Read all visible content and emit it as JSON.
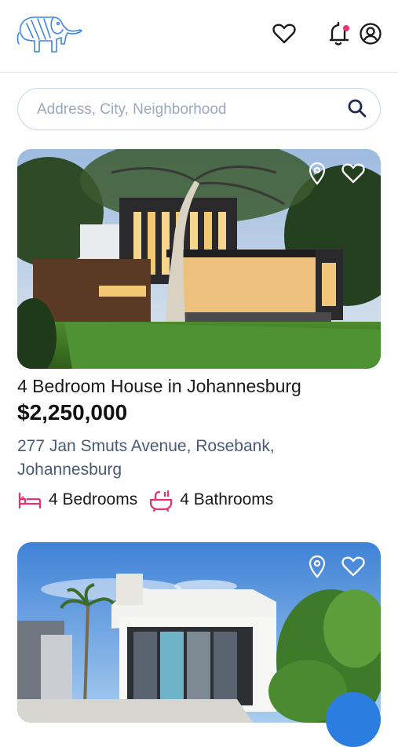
{
  "header": {
    "logo_icon": "elephant-logo",
    "favorites_icon": "heart-outline-icon",
    "notifications_icon": "bell-icon",
    "notification_dot_color": "#e8336e",
    "profile_icon": "user-circle-icon"
  },
  "search": {
    "placeholder": "Address, City, Neighborhood",
    "value": "",
    "icon": "search-icon"
  },
  "colors": {
    "accent": "#e8336e",
    "address_text": "#4a5a76",
    "search_border": "#c9d5e6",
    "fab": "#2b7de0"
  },
  "listings": [
    {
      "title": "4 Bedroom House in Johannesburg",
      "price": "$2,250,000",
      "address": "277 Jan Smuts Avenue, Rosebank, Johannesburg",
      "bedrooms": "4 Bedrooms",
      "bathrooms": "4 Bathrooms",
      "icons": [
        "map-pin-icon",
        "heart-outline-icon",
        "bed-icon",
        "bathtub-icon"
      ]
    },
    {
      "icons": [
        "map-pin-icon",
        "heart-outline-icon"
      ]
    }
  ]
}
